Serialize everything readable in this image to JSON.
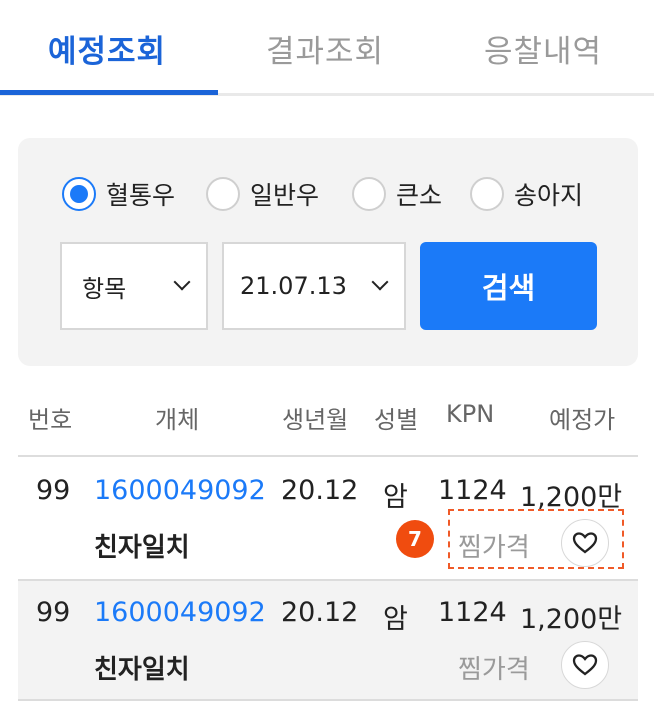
{
  "tabs": [
    {
      "label": "예정조회",
      "active": true
    },
    {
      "label": "결과조회",
      "active": false
    },
    {
      "label": "응찰내역",
      "active": false
    }
  ],
  "filters": {
    "radios": [
      {
        "label": "혈통우",
        "checked": true
      },
      {
        "label": "일반우",
        "checked": false
      },
      {
        "label": "큰소",
        "checked": false
      },
      {
        "label": "송아지",
        "checked": false
      }
    ],
    "item_select": "항목",
    "date_select": "21.07.13",
    "search_label": "검색"
  },
  "table": {
    "headers": [
      "번호",
      "개체",
      "생년월",
      "성별",
      "KPN",
      "예정가"
    ],
    "rows": [
      {
        "no": "99",
        "id": "1600049092",
        "birth": "20.12",
        "sex": "암",
        "kpn": "1124",
        "price": "1,200만",
        "name": "친자일치",
        "wish_label": "찜가격"
      },
      {
        "no": "99",
        "id": "1600049092",
        "birth": "20.12",
        "sex": "암",
        "kpn": "1124",
        "price": "1,200만",
        "name": "친자일치",
        "wish_label": "찜가격"
      }
    ]
  },
  "annotation": {
    "badge": "7"
  },
  "colors": {
    "accent": "#1b7af8",
    "tab_active": "#1b64d8",
    "badge": "#f04c0f"
  },
  "icons": {
    "heart": "heart-icon",
    "chevron": "chevron-down-icon"
  }
}
